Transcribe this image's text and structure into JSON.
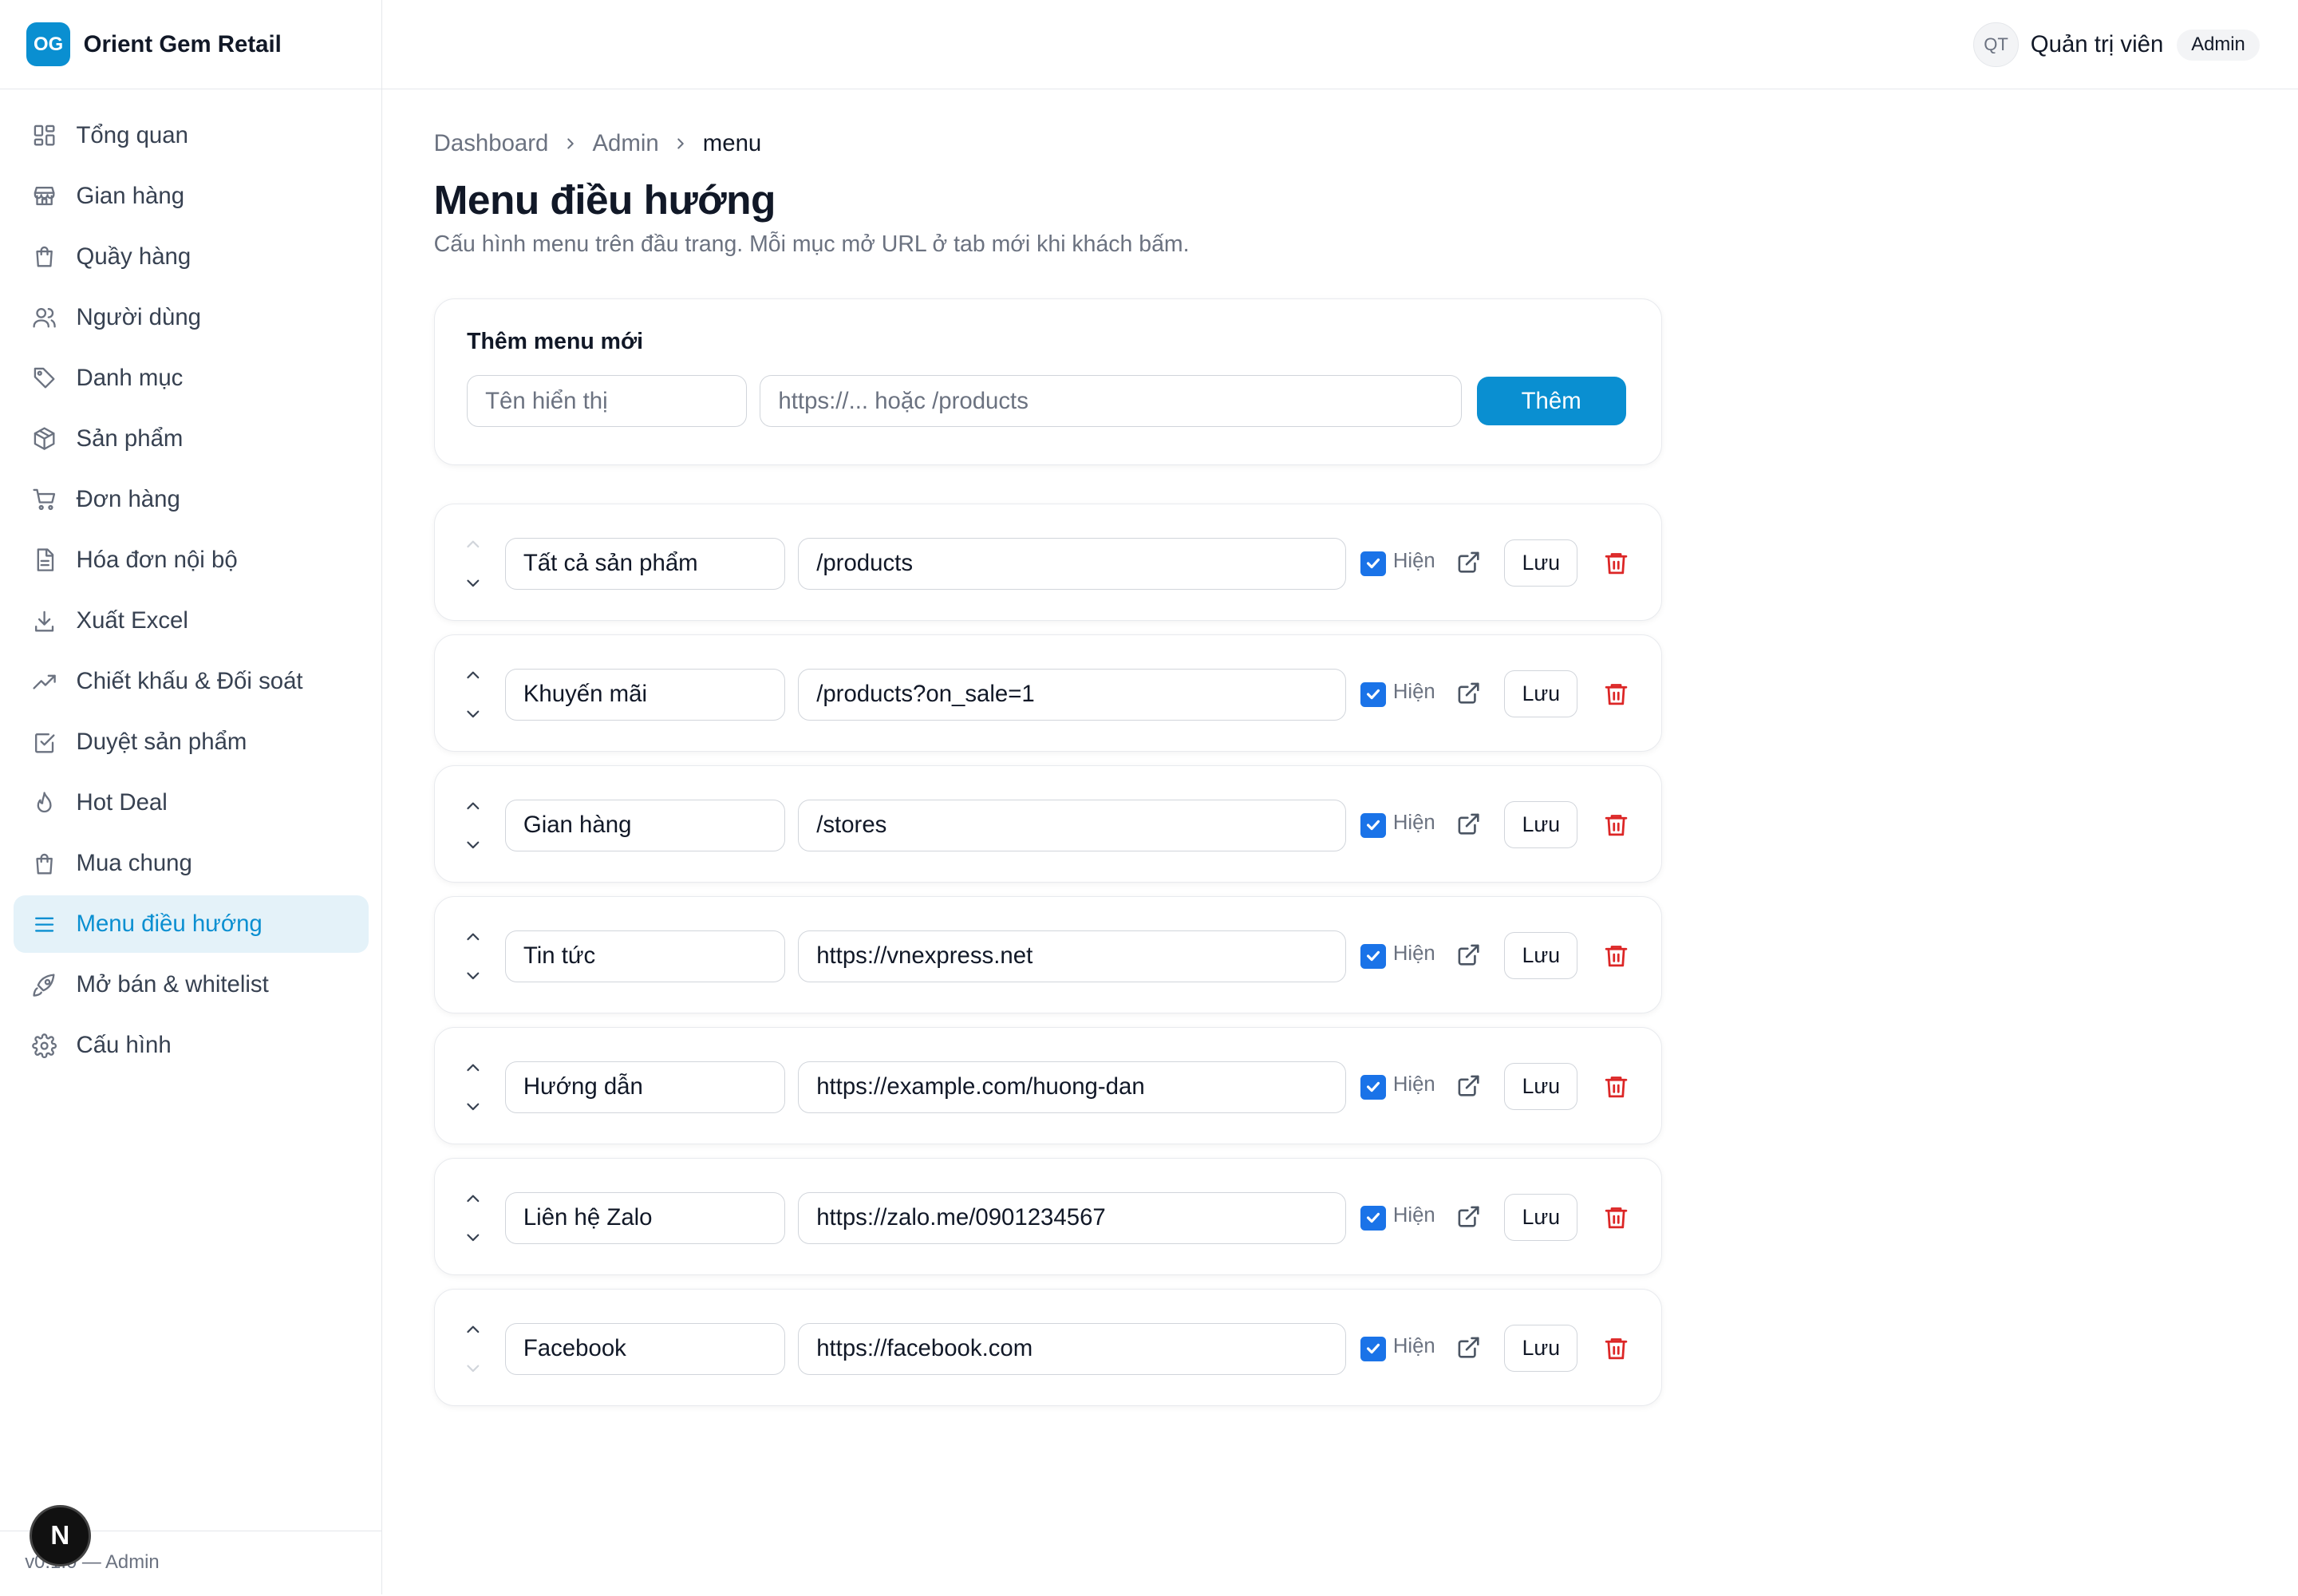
{
  "brand": {
    "logo_text": "OG",
    "name": "Orient Gem Retail",
    "color": "#0a8fd1"
  },
  "user": {
    "initials": "QT",
    "name": "Quản trị viên",
    "role": "Admin"
  },
  "sidebar": {
    "items": [
      {
        "label": "Tổng quan",
        "icon": "dashboard-grid-icon"
      },
      {
        "label": "Gian hàng",
        "icon": "store-icon"
      },
      {
        "label": "Quầy hàng",
        "icon": "shopping-bag-icon"
      },
      {
        "label": "Người dùng",
        "icon": "users-icon"
      },
      {
        "label": "Danh mục",
        "icon": "tag-icon"
      },
      {
        "label": "Sản phẩm",
        "icon": "package-icon"
      },
      {
        "label": "Đơn hàng",
        "icon": "cart-icon"
      },
      {
        "label": "Hóa đơn nội bộ",
        "icon": "document-icon"
      },
      {
        "label": "Xuất Excel",
        "icon": "download-icon"
      },
      {
        "label": "Chiết khấu & Đối soát",
        "icon": "trending-up-icon"
      },
      {
        "label": "Duyệt sản phẩm",
        "icon": "check-square-icon"
      },
      {
        "label": "Hot Deal",
        "icon": "flame-icon"
      },
      {
        "label": "Mua chung",
        "icon": "shopping-bag-icon"
      },
      {
        "label": "Menu điều hướng",
        "icon": "menu-icon",
        "active": true
      },
      {
        "label": "Mở bán & whitelist",
        "icon": "rocket-icon"
      },
      {
        "label": "Cấu hình",
        "icon": "gear-icon"
      }
    ],
    "footer": "v0.1.0 — Admin"
  },
  "breadcrumb": {
    "items": [
      "Dashboard",
      "Admin",
      "menu"
    ]
  },
  "page": {
    "title": "Menu điều hướng",
    "description": "Cấu hình menu trên đầu trang. Mỗi mục mở URL ở tab mới khi khách bấm."
  },
  "add_form": {
    "title": "Thêm menu mới",
    "name_placeholder": "Tên hiển thị",
    "url_placeholder": "https://... hoặc /products",
    "submit_label": "Thêm"
  },
  "menu_items": [
    {
      "name": "Tất cả sản phẩm",
      "url": "/products",
      "visible": true,
      "visible_label": "Hiện",
      "save_label": "Lưu"
    },
    {
      "name": "Khuyến mãi",
      "url": "/products?on_sale=1",
      "visible": true,
      "visible_label": "Hiện",
      "save_label": "Lưu"
    },
    {
      "name": "Gian hàng",
      "url": "/stores",
      "visible": true,
      "visible_label": "Hiện",
      "save_label": "Lưu"
    },
    {
      "name": "Tin tức",
      "url": "https://vnexpress.net",
      "visible": true,
      "visible_label": "Hiện",
      "save_label": "Lưu"
    },
    {
      "name": "Hướng dẫn",
      "url": "https://example.com/huong-dan",
      "visible": true,
      "visible_label": "Hiện",
      "save_label": "Lưu"
    },
    {
      "name": "Liên hệ Zalo",
      "url": "https://zalo.me/0901234567",
      "visible": true,
      "visible_label": "Hiện",
      "save_label": "Lưu"
    },
    {
      "name": "Facebook",
      "url": "https://facebook.com",
      "visible": true,
      "visible_label": "Hiện",
      "save_label": "Lưu"
    }
  ],
  "colors": {
    "accent": "#0a8fd1",
    "danger": "#dc2626",
    "checkbox": "#1a73e8"
  },
  "dev_badge": "N"
}
